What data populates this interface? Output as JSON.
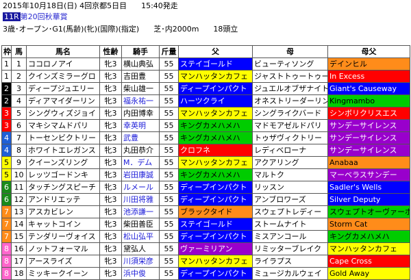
{
  "header": {
    "date_line": "2015年10月18日(日) 4回京都5日目",
    "start_time": "15:40発走",
    "race_number": "11R",
    "race_name": "第20回秋華賞",
    "conditions": "3歳･オープン･G1(馬齢)(牝)(国際)(指定)",
    "course": "芝･内2000m",
    "field_size": "18頭立"
  },
  "columns": [
    "枠",
    "馬",
    "馬名",
    "性齢",
    "騎手",
    "斤量",
    "父",
    "母",
    "母父"
  ],
  "colors": {
    "waku": {
      "1": {
        "bg": "#ffffff",
        "fg": "#000000"
      },
      "2": {
        "bg": "#000000",
        "fg": "#ffffff"
      },
      "3": {
        "bg": "#ff0000",
        "fg": "#ffffff"
      },
      "4": {
        "bg": "#1f5fd6",
        "fg": "#ffffff"
      },
      "5": {
        "bg": "#ffff00",
        "fg": "#000000"
      },
      "6": {
        "bg": "#1a8a1a",
        "fg": "#ffffff"
      },
      "7": {
        "bg": "#ff8c1a",
        "fg": "#ffffff"
      },
      "8": {
        "bg": "#ff66cc",
        "fg": "#ffffff"
      }
    },
    "sire": {
      "yellow": "#ffff00",
      "green": "#00cc00",
      "blue": "#0000ff",
      "red": "#ff0000",
      "purple": "#9900cc",
      "orange": "#ff8c1a",
      "white": "#ffffff"
    }
  },
  "rows": [
    {
      "waku": "1",
      "umaban": "1",
      "horse": "ココロノアイ",
      "sexage": "牝3",
      "jockey": "横山典弘",
      "jockey_blue": false,
      "weight": "55",
      "sire": "ステイゴールド",
      "sire_bg": "blue",
      "dam": "ビューティソング",
      "dam_bg": "white",
      "damsire": "デインヒル",
      "damsire_bg": "orange"
    },
    {
      "waku": "1",
      "umaban": "2",
      "horse": "クインズミラーグロ",
      "sexage": "牝3",
      "jockey": "吉田豊",
      "jockey_blue": false,
      "weight": "55",
      "sire": "マンハッタンカフェ",
      "sire_bg": "yellow",
      "dam": "ジャストトゥートゥー",
      "dam_bg": "white",
      "damsire": "In Excess",
      "damsire_bg": "red"
    },
    {
      "waku": "2",
      "umaban": "3",
      "horse": "ディープジュエリー",
      "sexage": "牝3",
      "jockey": "柴山雄一",
      "jockey_blue": false,
      "weight": "55",
      "sire": "ディープインパクト",
      "sire_bg": "blue",
      "dam": "ジュエルオブザナイト",
      "dam_bg": "white",
      "damsire": "Giant's Causeway",
      "damsire_bg": "blue"
    },
    {
      "waku": "2",
      "umaban": "4",
      "horse": "ディアマイダーリン",
      "sexage": "牝3",
      "jockey": "福永祐一",
      "jockey_blue": true,
      "weight": "55",
      "sire": "ハーツクライ",
      "sire_bg": "blue",
      "dam": "オネストリーダーリン",
      "dam_bg": "white",
      "damsire": "Kingmambo",
      "damsire_bg": "green"
    },
    {
      "waku": "3",
      "umaban": "5",
      "horse": "シングウィズジョイ",
      "sexage": "牝3",
      "jockey": "内田博幸",
      "jockey_blue": false,
      "weight": "55",
      "sire": "マンハッタンカフェ",
      "sire_bg": "yellow",
      "dam": "シングライクバード",
      "dam_bg": "white",
      "damsire": "シンボリクリスエス",
      "damsire_bg": "red"
    },
    {
      "waku": "3",
      "umaban": "6",
      "horse": "マキシマムドパリ",
      "sexage": "牝3",
      "jockey": "幸英明",
      "jockey_blue": true,
      "weight": "55",
      "sire": "キングカメハメハ",
      "sire_bg": "green",
      "dam": "マドモアゼルドパリ",
      "dam_bg": "white",
      "damsire": "サンデーサイレンス",
      "damsire_bg": "purple"
    },
    {
      "waku": "4",
      "umaban": "7",
      "horse": "トーセンビクトリー",
      "sexage": "牝3",
      "jockey": "武豊",
      "jockey_blue": true,
      "weight": "55",
      "sire": "キングカメハメハ",
      "sire_bg": "green",
      "dam": "トゥザヴィクトリー",
      "dam_bg": "white",
      "damsire": "サンデーサイレンス",
      "damsire_bg": "purple"
    },
    {
      "waku": "4",
      "umaban": "8",
      "horse": "ホワイトエレガンス",
      "sexage": "牝3",
      "jockey": "丸田恭介",
      "jockey_blue": false,
      "weight": "55",
      "sire": "クロフネ",
      "sire_bg": "red",
      "dam": "レディベローナ",
      "dam_bg": "white",
      "damsire": "サンデーサイレンス",
      "damsire_bg": "purple"
    },
    {
      "waku": "5",
      "umaban": "9",
      "horse": "クイーンズリング",
      "sexage": "牝3",
      "jockey": "M．デム",
      "jockey_blue": true,
      "weight": "55",
      "sire": "マンハッタンカフェ",
      "sire_bg": "yellow",
      "dam": "アクアリング",
      "dam_bg": "white",
      "damsire": "Anabaa",
      "damsire_bg": "orange"
    },
    {
      "waku": "5",
      "umaban": "10",
      "horse": "レッツゴードンキ",
      "sexage": "牝3",
      "jockey": "岩田康誠",
      "jockey_blue": true,
      "weight": "55",
      "sire": "キングカメハメハ",
      "sire_bg": "green",
      "dam": "マルトク",
      "dam_bg": "white",
      "damsire": "マーベラスサンデー",
      "damsire_bg": "purple"
    },
    {
      "waku": "6",
      "umaban": "11",
      "horse": "タッチングスピーチ",
      "sexage": "牝3",
      "jockey": "ルメール",
      "jockey_blue": true,
      "weight": "55",
      "sire": "ディープインパクト",
      "sire_bg": "blue",
      "dam": "リッスン",
      "dam_bg": "white",
      "damsire": "Sadler's Wells",
      "damsire_bg": "blue"
    },
    {
      "waku": "6",
      "umaban": "12",
      "horse": "アンドリエッテ",
      "sexage": "牝3",
      "jockey": "川田将雅",
      "jockey_blue": true,
      "weight": "55",
      "sire": "ディープインパクト",
      "sire_bg": "blue",
      "dam": "アンブロワーズ",
      "dam_bg": "white",
      "damsire": "Silver Deputy",
      "damsire_bg": "blue"
    },
    {
      "waku": "7",
      "umaban": "13",
      "horse": "アスカビレン",
      "sexage": "牝3",
      "jockey": "池添謙一",
      "jockey_blue": true,
      "weight": "55",
      "sire": "ブラックタイド",
      "sire_bg": "orange",
      "dam": "スウェプトレディー",
      "dam_bg": "white",
      "damsire": "スウェプトオーヴァーボード",
      "damsire_bg": "green"
    },
    {
      "waku": "7",
      "umaban": "14",
      "horse": "キャットコイン",
      "sexage": "牝3",
      "jockey": "柴田善臣",
      "jockey_blue": false,
      "weight": "55",
      "sire": "ステイゴールド",
      "sire_bg": "blue",
      "dam": "ストームナイト",
      "dam_bg": "white",
      "damsire": "Storm Cat",
      "damsire_bg": "orange"
    },
    {
      "waku": "7",
      "umaban": "15",
      "horse": "テンダリーヴォイス",
      "sexage": "牝3",
      "jockey": "松山弘平",
      "jockey_blue": true,
      "weight": "55",
      "sire": "ディープインパクト",
      "sire_bg": "blue",
      "dam": "ミスアンコール",
      "dam_bg": "white",
      "damsire": "キングカメハメハ",
      "damsire_bg": "green"
    },
    {
      "waku": "8",
      "umaban": "16",
      "horse": "ノットフォーマル",
      "sexage": "牝3",
      "jockey": "黛弘人",
      "jockey_blue": false,
      "weight": "55",
      "sire": "ヴァーミリアン",
      "sire_bg": "purple",
      "dam": "リミッターブレイク",
      "dam_bg": "white",
      "damsire": "マンハッタンカフェ",
      "damsire_bg": "yellow"
    },
    {
      "waku": "8",
      "umaban": "17",
      "horse": "アースライズ",
      "sexage": "牝3",
      "jockey": "川須栄彦",
      "jockey_blue": true,
      "weight": "55",
      "sire": "マンハッタンカフェ",
      "sire_bg": "yellow",
      "dam": "ライラプス",
      "dam_bg": "white",
      "damsire": "Cape Cross",
      "damsire_bg": "red"
    },
    {
      "waku": "8",
      "umaban": "18",
      "horse": "ミッキークイーン",
      "sexage": "牝3",
      "jockey": "浜中俊",
      "jockey_blue": true,
      "weight": "55",
      "sire": "ディープインパクト",
      "sire_bg": "blue",
      "dam": "ミュージカルウェイ",
      "dam_bg": "white",
      "damsire": "Gold Away",
      "damsire_bg": "yellow"
    }
  ]
}
